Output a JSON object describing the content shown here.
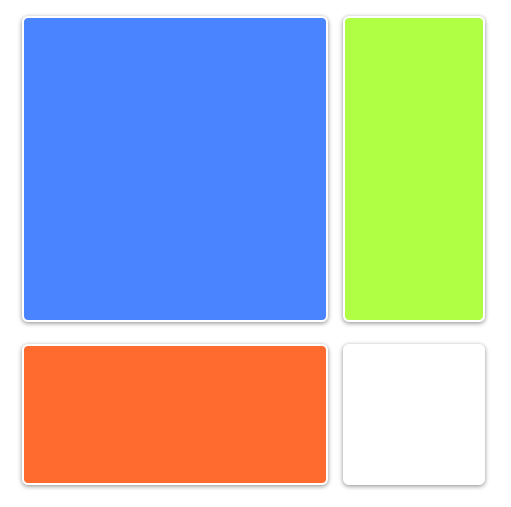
{
  "tiles": [
    {
      "id": "tile-blue",
      "color": "#4A84FF"
    },
    {
      "id": "tile-green",
      "color": "#B0FF45"
    },
    {
      "id": "tile-orange",
      "color": "#FF6A2E"
    },
    {
      "id": "tile-white",
      "color": "#FFFFFF"
    }
  ]
}
